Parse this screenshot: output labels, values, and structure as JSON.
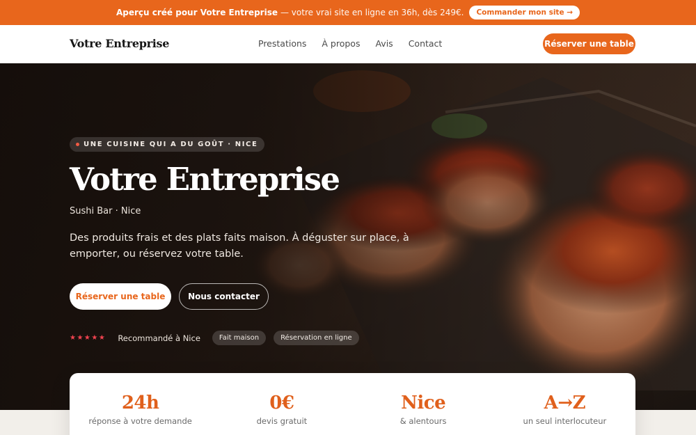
{
  "promo": {
    "bold": "Aperçu créé pour Votre Entreprise",
    "text": "— votre vrai site en ligne en 36h, dès 249€.",
    "button": "Commander mon site →"
  },
  "nav": {
    "brand": "Votre Entreprise",
    "links": [
      "Prestations",
      "À propos",
      "Avis",
      "Contact"
    ],
    "cta": "Réserver une table"
  },
  "hero": {
    "eyebrow": "UNE CUISINE QUI A DU GOÛT · NICE",
    "title": "Votre Entreprise",
    "subtitle": "Sushi Bar · Nice",
    "description": "Des produits frais et des plats faits maison. À déguster sur place, à emporter, ou réservez votre table.",
    "primary_button": "Réserver une table",
    "secondary_button": "Nous contacter",
    "stars": "★★★★★",
    "rating_text": "Recommandé à Nice",
    "chips": [
      "Fait maison",
      "Réservation en ligne"
    ]
  },
  "stats": [
    {
      "value": "24h",
      "label": "réponse à votre demande"
    },
    {
      "value": "0€",
      "label": "devis gratuit"
    },
    {
      "value": "Nice",
      "label": "& alentours"
    },
    {
      "value": "A→Z",
      "label": "un seul interlocuteur"
    }
  ],
  "colors": {
    "accent": "#e8661c",
    "star": "#f0434f"
  }
}
